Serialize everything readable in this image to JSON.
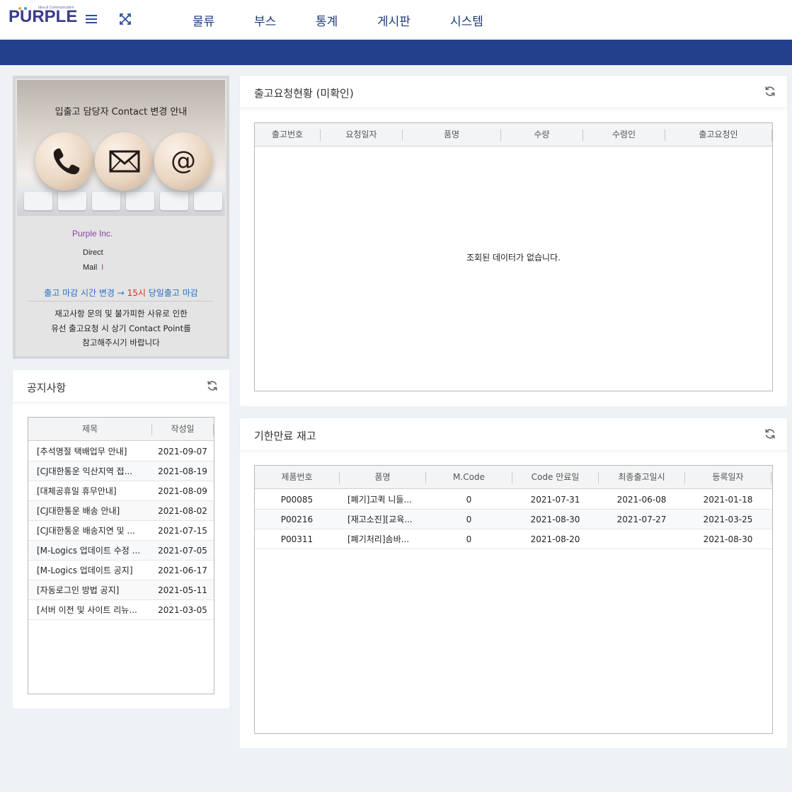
{
  "app": {
    "logo_text": "PURPLE",
    "logo_sub": "Idea & Communication"
  },
  "nav": {
    "items": [
      {
        "label": "물류"
      },
      {
        "label": "부스"
      },
      {
        "label": "통계"
      },
      {
        "label": "게시판"
      },
      {
        "label": "시스템"
      }
    ]
  },
  "colors": {
    "primary_bar": "#23418a",
    "nav_text": "#1f3a78",
    "brand_purple": "#8b3fa8"
  },
  "promo": {
    "title": "입출고 담당자 Contact 변경 안내",
    "company": "Purple Inc.",
    "direct_label": "Direct",
    "mail_label": "Mail",
    "mail_cursor": "I",
    "deadline_prefix": "출고 마감 시간 변경 → ",
    "deadline_hour": "15시",
    "deadline_suffix": " 당일출고 마감",
    "note_line1": "재고사항 문의 및 불가피한 사유로 인한",
    "note_line2": "유선 출고요청 시 상기 Contact Point를",
    "note_line3": "참고해주시기 바랍니다",
    "icons": [
      "phone-icon",
      "envelope-icon",
      "at-icon"
    ]
  },
  "notice": {
    "title": "공지사항",
    "columns": [
      "제목",
      "작성일"
    ],
    "rows": [
      {
        "title": "[추석명절 택배업무 안내]",
        "date": "2021-09-07"
      },
      {
        "title": "[CJ대한통운 익산지역 접...",
        "date": "2021-08-19"
      },
      {
        "title": "[대체공휴일 휴무안내]",
        "date": "2021-08-09"
      },
      {
        "title": "[CJ대한통운 배송 안내]",
        "date": "2021-08-02"
      },
      {
        "title": "[CJ대한통운 배송지연 및 ...",
        "date": "2021-07-15"
      },
      {
        "title": "[M-Logics 업데이트 수정 ...",
        "date": "2021-07-05"
      },
      {
        "title": "[M-Logics 업데이트 공지]",
        "date": "2021-06-17"
      },
      {
        "title": "[자동로그인 방법 공지]",
        "date": "2021-05-11"
      },
      {
        "title": "[서버 이전 및 사이트 리뉴...",
        "date": "2021-03-05"
      }
    ]
  },
  "outbound": {
    "title": "출고요청현황 (미확인)",
    "columns": [
      "출고번호",
      "요청일자",
      "품명",
      "수량",
      "수령인",
      "출고요청인"
    ],
    "empty_message": "조회된 데이터가 없습니다."
  },
  "expiry": {
    "title": "기한만료 재고",
    "columns": [
      "제품번호",
      "품명",
      "M.Code",
      "Code 만료일",
      "최종출고일시",
      "등록일자"
    ],
    "rows": [
      {
        "code": "P00085",
        "name": "[폐기]고퀵 니들...",
        "mcode": "0",
        "expire": "2021-07-31",
        "last_out": "2021-06-08",
        "reg": "2021-01-18"
      },
      {
        "code": "P00216",
        "name": "[재고소진][교육...",
        "mcode": "0",
        "expire": "2021-08-30",
        "last_out": "2021-07-27",
        "reg": "2021-03-25"
      },
      {
        "code": "P00311",
        "name": "[폐기처리]솜바...",
        "mcode": "0",
        "expire": "2021-08-20",
        "last_out": "",
        "reg": "2021-08-30"
      }
    ]
  }
}
